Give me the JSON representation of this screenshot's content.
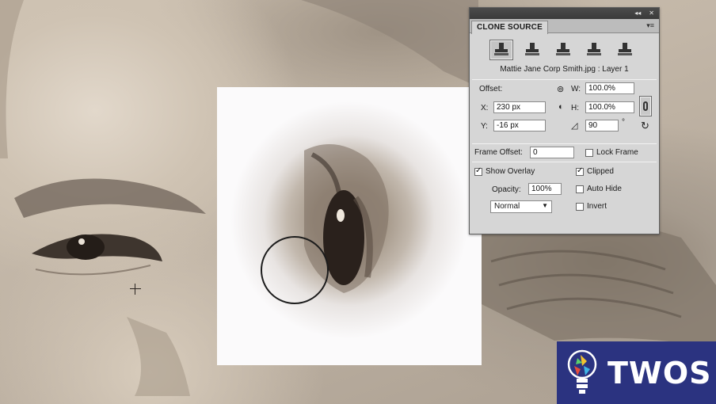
{
  "panel": {
    "title": "CLONE SOURCE",
    "titlebar_collapse": "◂◂",
    "titlebar_close": "✕",
    "menu_icon": "panel-menu-icon",
    "source_buttons": [
      {
        "name": "clone-source-1",
        "active": true
      },
      {
        "name": "clone-source-2",
        "active": false
      },
      {
        "name": "clone-source-3",
        "active": false
      },
      {
        "name": "clone-source-4",
        "active": false
      },
      {
        "name": "clone-source-5",
        "active": false
      }
    ],
    "source_name": "Mattie Jane Corp Smith.jpg : Layer 1",
    "offset_label": "Offset:",
    "x_label": "X:",
    "x_value": "230 px",
    "y_label": "Y:",
    "y_value": "-16 px",
    "w_label": "W:",
    "w_value": "100.0%",
    "h_label": "H:",
    "h_value": "100.0%",
    "angle_value": "90",
    "angle_unit": "°",
    "frame_offset_label": "Frame Offset:",
    "frame_offset_value": "0",
    "lock_frame_label": "Lock Frame",
    "lock_frame_checked": false,
    "show_overlay_label": "Show Overlay",
    "show_overlay_checked": true,
    "opacity_label": "Opacity:",
    "opacity_value": "100%",
    "blend_mode": "Normal",
    "clipped_label": "Clipped",
    "clipped_checked": true,
    "auto_hide_label": "Auto Hide",
    "auto_hide_checked": false,
    "invert_label": "Invert",
    "invert_checked": false
  },
  "badge": {
    "text": "TWOS",
    "background": "#2b3380"
  }
}
